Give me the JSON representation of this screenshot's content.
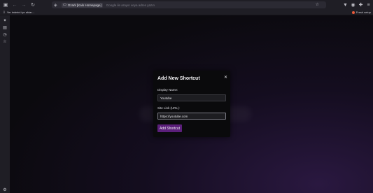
{
  "toolbar": {
    "back_icon": "arrow-left-icon",
    "forward_icon": "arrow-right-icon",
    "reload_icon": "reload-icon",
    "sidebar_icon": "sidebar-icon",
    "tab_title": "Ozark [Kalo Homepage]",
    "url_placeholder": "Google ile arayın veya adres yazın"
  },
  "bookmarks": {
    "import_label": "Yer imlerini içe aktar…",
    "fresh_label": "Fresh setup"
  },
  "modal": {
    "title": "Add New Shortcut",
    "close_glyph": "✕",
    "display_name_label": "Display Name:",
    "display_name_value": "Youtube",
    "site_link_label": "Site Link (URL):",
    "site_link_value": "https://youtube.com",
    "submit_label": "Add Shortcut"
  },
  "colors": {
    "accent": "#5b1f7a",
    "background": "#0c0b0f",
    "chrome": "#1f1e25"
  }
}
